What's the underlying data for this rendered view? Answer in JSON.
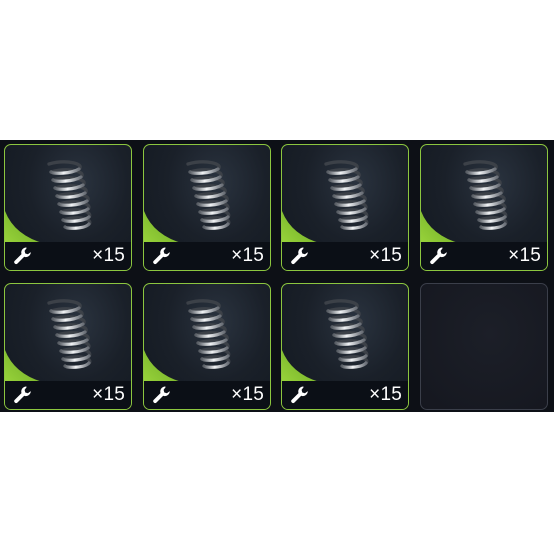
{
  "inventory": {
    "accent_color": "#8cc63f",
    "empty_border_color": "#3b3f4a",
    "slots": [
      {
        "item_icon": "spring-icon",
        "badge_icon": "wrench-icon",
        "count": "×15",
        "filled": true
      },
      {
        "item_icon": "spring-icon",
        "badge_icon": "wrench-icon",
        "count": "×15",
        "filled": true
      },
      {
        "item_icon": "spring-icon",
        "badge_icon": "wrench-icon",
        "count": "×15",
        "filled": true
      },
      {
        "item_icon": "spring-icon",
        "badge_icon": "wrench-icon",
        "count": "×15",
        "filled": true
      },
      {
        "item_icon": "spring-icon",
        "badge_icon": "wrench-icon",
        "count": "×15",
        "filled": true
      },
      {
        "item_icon": "spring-icon",
        "badge_icon": "wrench-icon",
        "count": "×15",
        "filled": true
      },
      {
        "item_icon": "spring-icon",
        "badge_icon": "wrench-icon",
        "count": "×15",
        "filled": true
      },
      {
        "filled": false
      }
    ]
  }
}
